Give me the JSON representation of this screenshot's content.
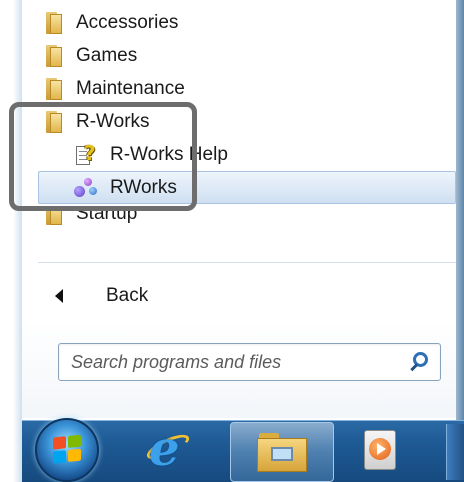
{
  "programs": {
    "items": [
      {
        "label": "Accessories",
        "icon": "folder-icon"
      },
      {
        "label": "Games",
        "icon": "folder-icon"
      },
      {
        "label": "Maintenance",
        "icon": "folder-icon"
      },
      {
        "label": "R-Works",
        "icon": "folder-icon"
      }
    ],
    "subitems": [
      {
        "label": "R-Works Help",
        "icon": "help-icon"
      },
      {
        "label": "RWorks",
        "icon": "rworks-app-icon",
        "highlighted": true
      }
    ],
    "partial_item": {
      "label": "Startup",
      "icon": "folder-icon"
    }
  },
  "navigation": {
    "back_label": "Back"
  },
  "search": {
    "placeholder": "Search programs and files"
  },
  "taskbar": {
    "buttons": [
      "start-orb",
      "internet-explorer-icon",
      "windows-explorer-icon",
      "media-player-icon"
    ]
  },
  "colors": {
    "taskbar": "#1e5a95",
    "highlight_border": "#6d6d6d",
    "selection": "#dde9f6"
  }
}
